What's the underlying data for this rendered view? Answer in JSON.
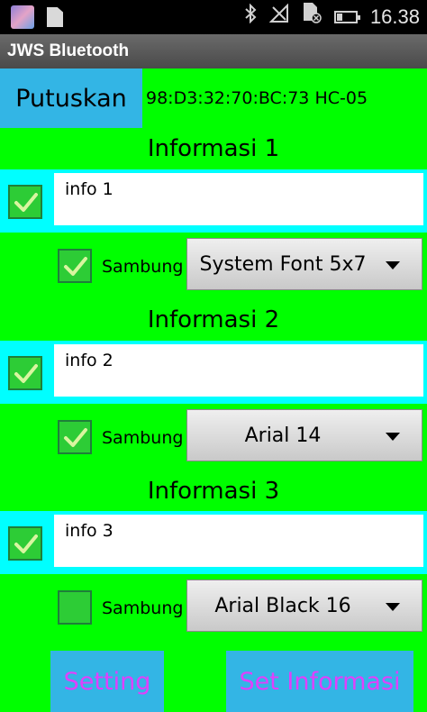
{
  "status_bar": {
    "time": "16.38",
    "icons": [
      "app-icon",
      "sd-card-icon",
      "bluetooth-icon",
      "no-signal-icon",
      "sd-card-error-icon",
      "battery-icon"
    ],
    "battery_level": 0.3
  },
  "app": {
    "title": "JWS Bluetooth"
  },
  "connection": {
    "disconnect_label": "Putuskan",
    "device": "98:D3:32:70:BC:73 HC-05"
  },
  "sections": [
    {
      "title": "Informasi 1",
      "enabled": true,
      "text": "info 1",
      "sambung_label": "Sambung",
      "sambung_checked": true,
      "font": "System Font 5x7"
    },
    {
      "title": "Informasi 2",
      "enabled": true,
      "text": "info 2",
      "sambung_label": "Sambung",
      "sambung_checked": true,
      "font": "Arial 14"
    },
    {
      "title": "Informasi 3",
      "enabled": true,
      "text": "info 3",
      "sambung_label": "Sambung",
      "sambung_checked": false,
      "font": "Arial Black 16"
    }
  ],
  "footer": {
    "setting_label": "Setting",
    "set_info_label": "Set Informasi"
  },
  "colors": {
    "background": "#00FF00",
    "info_row": "#00FFFF",
    "button": "#33B5E5",
    "footer_text": "#E040FB"
  }
}
